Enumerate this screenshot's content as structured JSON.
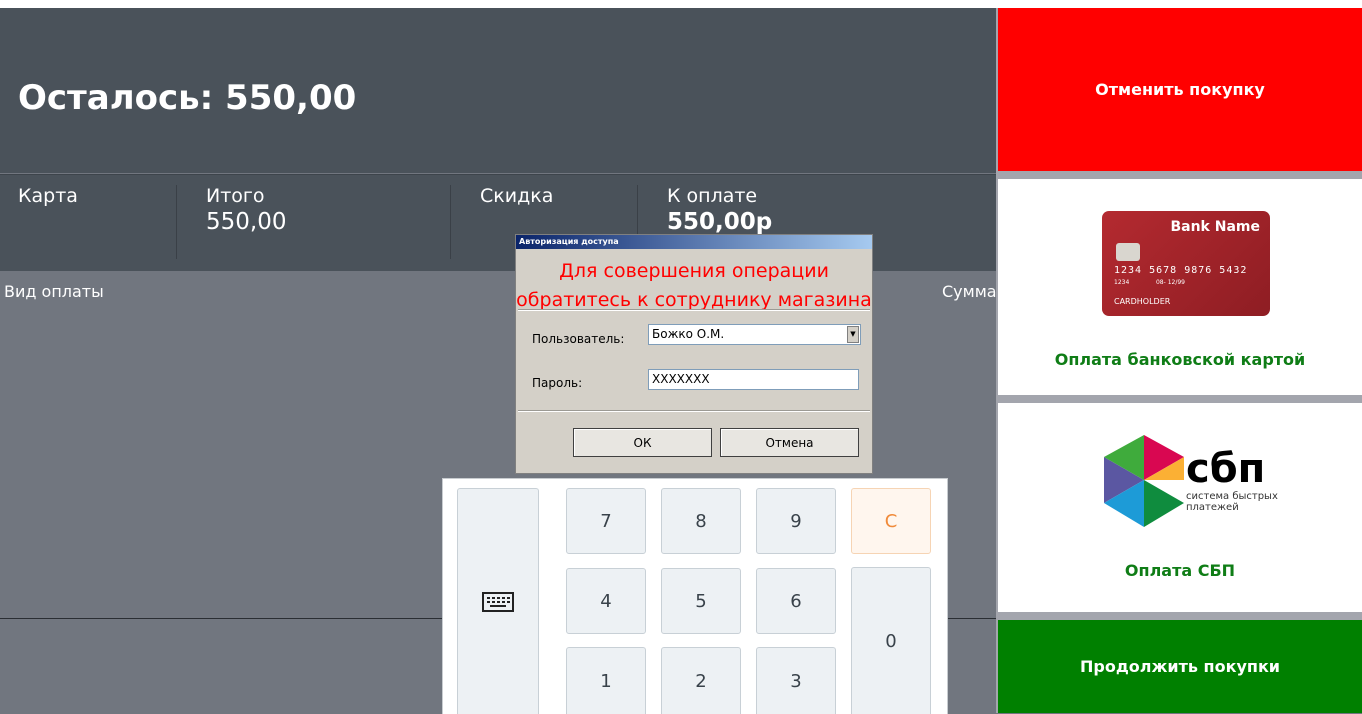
{
  "remaining": {
    "label": "Осталось: 550,00"
  },
  "totals": {
    "card_label": "Карта",
    "total_label": "Итого",
    "total_value": "550,00",
    "discount_label": "Скидка",
    "to_pay_label": "К оплате",
    "to_pay_value": "550,00р"
  },
  "payments_table": {
    "col_type": "Вид оплаты",
    "col_sum": "Сумма"
  },
  "actions": {
    "cancel_purchase": "Отменить покупку",
    "pay_card": "Оплата банковской картой",
    "pay_sbp": "Оплата СБП",
    "continue_shopping": "Продолжить покупки"
  },
  "card_image": {
    "bank_name": "Bank Name",
    "number": "1234 5678 9876 5432",
    "small_num": "1234",
    "valid": "08- 12/99",
    "holder": "CARDHOLDER"
  },
  "sbp_logo": {
    "big": "сбп",
    "line1": "система быстрых",
    "line2": "платежей"
  },
  "keypad": {
    "keyboard_icon": "keyboard-icon",
    "keys": {
      "k7": "7",
      "k8": "8",
      "k9": "9",
      "clear": "C",
      "k4": "4",
      "k5": "5",
      "k6": "6",
      "k0": "0",
      "k1": "1",
      "k2": "2",
      "k3": "3"
    }
  },
  "dialog": {
    "title": "Авторизация доступа",
    "message_line1": "Для совершения операции",
    "message_line2": "обратитесь к сотруднику магазина",
    "user_label": "Пользователь:",
    "user_value": "Божко О.М.",
    "password_label": "Пароль:",
    "password_value": "XXXXXXX",
    "ok": "ОК",
    "cancel": "Отмена"
  },
  "colors": {
    "cancel": "#ff0000",
    "continue": "#008000",
    "caption_green": "#0f7d16",
    "dark_panel": "#4a525a"
  }
}
